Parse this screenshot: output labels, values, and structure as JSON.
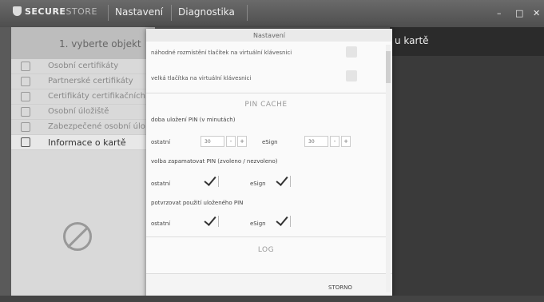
{
  "app": {
    "brand_bold": "SECURE",
    "brand_light": "STORE",
    "menu": {
      "settings": "Nastavení",
      "diagnostics": "Diagnostika"
    }
  },
  "window": {
    "minimize": "–",
    "restore": "□",
    "close": "✕"
  },
  "left_panel": {
    "header": "1. vyberte objekt",
    "items": [
      {
        "label": "Osobní certifikáty",
        "icon": "certificate-icon",
        "active": false
      },
      {
        "label": "Partnerské certifikáty",
        "icon": "partner-certificate-icon",
        "active": false
      },
      {
        "label": "Certifikáty certifikačních",
        "icon": "authority-certificate-icon",
        "active": false
      },
      {
        "label": "Osobní úložiště",
        "icon": "folder-icon",
        "active": false
      },
      {
        "label": "Zabezpečené osobní úlo",
        "icon": "secure-storage-icon",
        "active": false
      },
      {
        "label": "Informace o kartě",
        "icon": "card-info-icon",
        "active": true
      }
    ],
    "empty_icon": "no-selection-icon"
  },
  "right_header": "u kartě",
  "dialog": {
    "title": "Nastavení",
    "row_random_keys": "náhodné rozmístění tlačítek na virtuální klávesnici",
    "row_big_keys": "velká tlačítka na virtuální klávesnici",
    "pin_cache": {
      "title": "PIN CACHE",
      "duration_label": "doba uložení PIN (v minutách)",
      "other_label": "ostatní",
      "other_value": "30",
      "esign_label": "eSign",
      "esign_value": "30",
      "minus": "-",
      "plus": "+",
      "remember_label": "volba zapamatovat PIN (zvoleno / nezvoleno)",
      "confirm_label": "potvrzovat použití uloženého PIN"
    },
    "log_title": "LOG",
    "storno": "STORNO"
  }
}
